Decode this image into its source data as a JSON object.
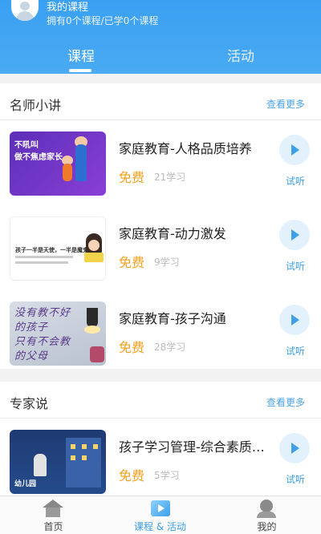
{
  "header": {
    "title": "我的课程",
    "subtitle": "拥有0个课程/已学0个课程",
    "tabs": [
      {
        "label": "课程",
        "active": true
      },
      {
        "label": "活动",
        "active": false
      }
    ]
  },
  "sections": [
    {
      "title": "名师小讲",
      "more_label": "查看更多",
      "items": [
        {
          "title": "家庭教育-人格品质培养",
          "price": "免费",
          "count": "21学习",
          "try_label": "试听",
          "thumb_text": [
            "不吼叫",
            "做不焦虑家长"
          ]
        },
        {
          "title": "家庭教育-动力激发",
          "price": "免费",
          "count": "9学习",
          "try_label": "试听",
          "thumb_text": [
            "孩子一半是天使，一半是魔鬼"
          ]
        },
        {
          "title": "家庭教育-孩子沟通",
          "price": "免费",
          "count": "28学习",
          "try_label": "试听",
          "thumb_text": [
            "没有教不好",
            "的孩子",
            "只有不会教",
            "的父母"
          ]
        }
      ]
    },
    {
      "title": "专家说",
      "more_label": "查看更多",
      "items": [
        {
          "title": "孩子学习管理-综合素质…",
          "price": "免费",
          "count": "5学习",
          "try_label": "试听",
          "thumb_text": [
            "幼儿园"
          ]
        }
      ]
    }
  ],
  "bottom_nav": [
    {
      "label": "首页",
      "icon": "home-icon",
      "active": false
    },
    {
      "label": "课程 & 活动",
      "icon": "course-icon",
      "active": true
    },
    {
      "label": "我的",
      "icon": "user-icon",
      "active": false
    }
  ],
  "colors": {
    "header_blue": "#3aa0f2",
    "accent_blue": "#3d9fea",
    "price_orange": "#f0a020"
  }
}
